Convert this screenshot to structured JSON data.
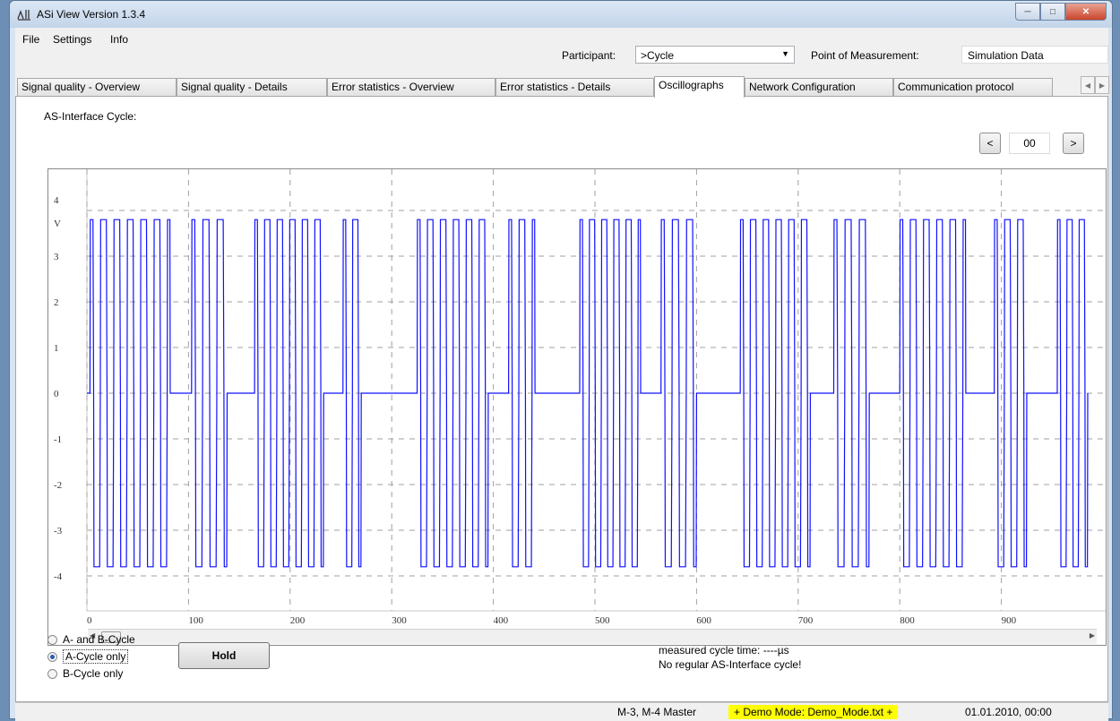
{
  "window": {
    "title": "ASi View Version 1.3.4"
  },
  "menu": [
    "File",
    "Settings",
    "Info"
  ],
  "participant": {
    "label": "Participant:",
    "value": ">Cycle"
  },
  "measurement": {
    "label": "Point of Measurement:",
    "value": "Simulation Data"
  },
  "tabs": [
    "Signal quality - Overview",
    "Signal quality - Details",
    "Error statistics - Overview",
    "Error statistics - Details",
    "Oscillographs",
    "Network Configuration",
    "Communication protocol"
  ],
  "active_tab": "Oscillographs",
  "oscillograph": {
    "cycle_label": "AS-Interface Cycle:",
    "prev_label": "<",
    "next_label": ">",
    "cycle_number": "00"
  },
  "chart_data": {
    "type": "line",
    "title": "",
    "xlabel": "",
    "ylabel": "V",
    "xlim": [
      0,
      985
    ],
    "ylim": [
      -4,
      4
    ],
    "x_ticks": [
      "0",
      "100",
      "200",
      "300",
      "400",
      "500",
      "600",
      "700",
      "800",
      "900"
    ],
    "y_ticks": [
      "4",
      "3",
      "2",
      "1",
      "0",
      "-1",
      "-2",
      "-3",
      "-4"
    ],
    "grid": "dashed",
    "series": [
      {
        "color": "#1010ff",
        "bursts": [
          {
            "start": 3,
            "end": 82,
            "pulses": 12
          },
          {
            "start": 103,
            "end": 138,
            "pulses": 5
          },
          {
            "start": 165,
            "end": 233,
            "pulses": 11
          },
          {
            "start": 252,
            "end": 270,
            "pulses": 3
          },
          {
            "start": 325,
            "end": 395,
            "pulses": 11
          },
          {
            "start": 415,
            "end": 441,
            "pulses": 4
          },
          {
            "start": 485,
            "end": 545,
            "pulses": 10
          },
          {
            "start": 565,
            "end": 600,
            "pulses": 5
          },
          {
            "start": 643,
            "end": 712,
            "pulses": 11
          },
          {
            "start": 735,
            "end": 770,
            "pulses": 5
          },
          {
            "start": 800,
            "end": 865,
            "pulses": 10
          },
          {
            "start": 893,
            "end": 925,
            "pulses": 5
          },
          {
            "start": 955,
            "end": 985,
            "pulses": 5
          }
        ],
        "amplitude": 3.8
      }
    ]
  },
  "cycle_options": [
    {
      "label": "A- and B-Cycle",
      "selected": false
    },
    {
      "label": "A-Cycle only",
      "selected": true
    },
    {
      "label": "B-Cycle only",
      "selected": false
    }
  ],
  "hold_label": "Hold",
  "info": {
    "cycle_time": "measured cycle time: ----µs",
    "warning": "No regular AS-Interface cycle!"
  },
  "status": {
    "master": "M-3, M-4 Master",
    "demo": "+ Demo Mode: Demo_Mode.txt +",
    "datetime": "01.01.2010, 00:00"
  }
}
